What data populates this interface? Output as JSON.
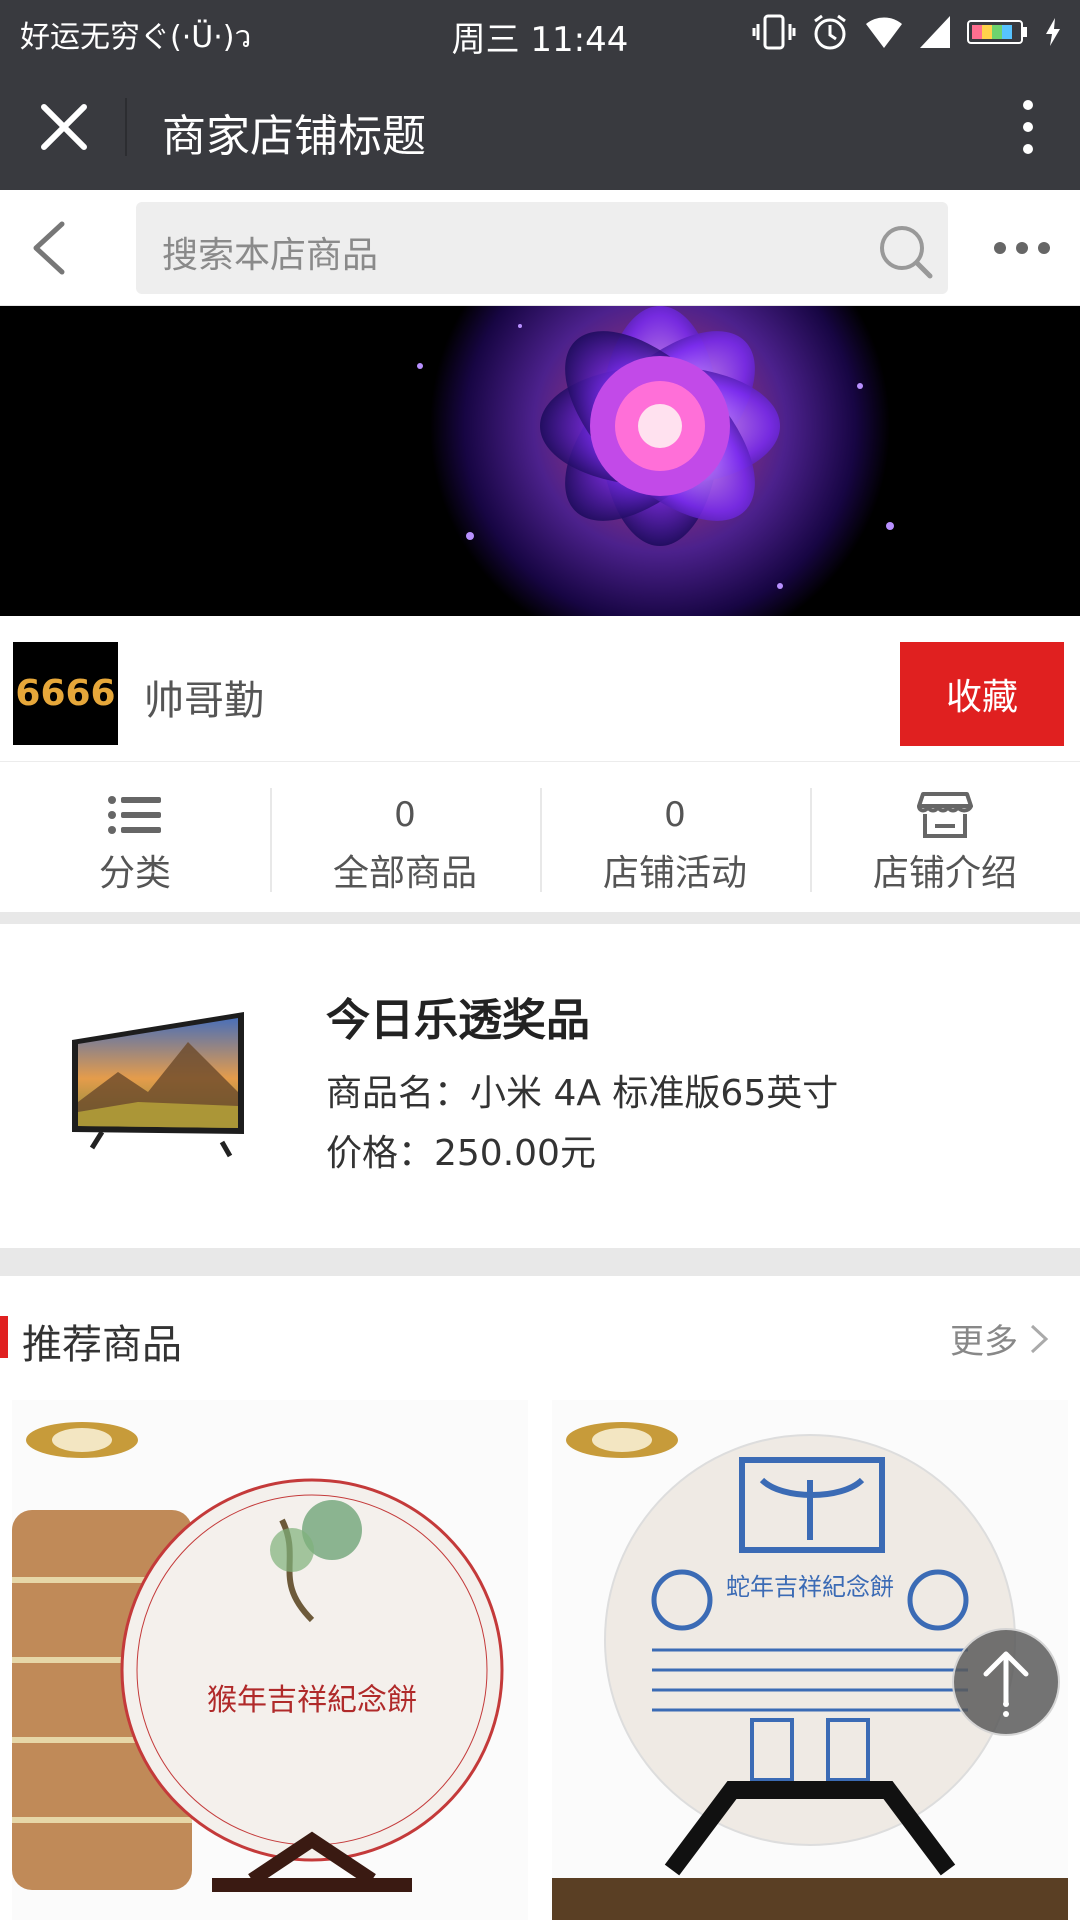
{
  "status_bar": {
    "carrier": "好运无穷ぐ(·Ü·)ว",
    "time": "周三 11:44"
  },
  "title_bar": {
    "title": "商家店铺标题"
  },
  "search": {
    "placeholder": "搜索本店商品"
  },
  "shop": {
    "logo_text": "6666",
    "name": "帅哥勤",
    "favorite_label": "收藏"
  },
  "nav": [
    {
      "top": "",
      "label": "分类",
      "icon": "list-icon"
    },
    {
      "top": "0",
      "label": "全部商品"
    },
    {
      "top": "0",
      "label": "店铺活动"
    },
    {
      "top": "",
      "label": "店铺介绍",
      "icon": "store-icon"
    }
  ],
  "lottery": {
    "heading": "今日乐透奖品",
    "product_name": "商品名：小米 4A 标准版65英寸",
    "price": "价格：250.00元"
  },
  "recommended": {
    "title": "推荐商品",
    "more_label": "更多",
    "products": [
      {
        "print": "猴年吉祥紀念餅"
      },
      {
        "print": "蛇年吉祥紀念餅"
      }
    ]
  },
  "colors": {
    "dark_bar": "#393a3f",
    "accent_red": "#e02020",
    "separator": "#e8e8e8"
  }
}
